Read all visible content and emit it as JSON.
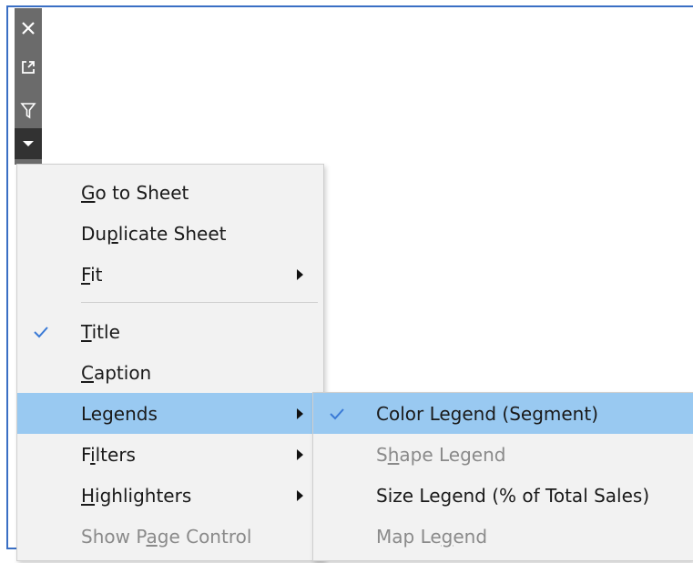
{
  "colors": {
    "toolbar": "#6b6b6b",
    "toolbar_dark": "#323232",
    "menu_bg": "#f2f2f2",
    "highlight": "#99c9f1",
    "check": "#3a7ad6",
    "disabled_text": "#8a8a8a",
    "frame": "#3a6fc4"
  },
  "toolbar": {
    "icons": [
      "close-icon",
      "popout-icon",
      "filter-icon",
      "more-options-icon"
    ]
  },
  "menu": {
    "items": [
      {
        "pre": "",
        "key": "G",
        "post": "o to Sheet"
      },
      {
        "pre": "Du",
        "key": "p",
        "post": "licate Sheet"
      },
      {
        "pre": "",
        "key": "F",
        "post": "it"
      },
      {
        "pre": "",
        "key": "T",
        "post": "itle",
        "checked": true
      },
      {
        "pre": "",
        "key": "C",
        "post": "aption"
      },
      {
        "pre": "Legends",
        "key": "",
        "post": ""
      },
      {
        "pre": "F",
        "key": "i",
        "post": "lters"
      },
      {
        "pre": "",
        "key": "H",
        "post": "ighlighters"
      },
      {
        "pre": "Show P",
        "key": "a",
        "post": "ge Control",
        "disabled": true
      }
    ]
  },
  "submenu": {
    "items": [
      {
        "pre": "Color Legend (Segment)",
        "key": "",
        "post": "",
        "checked": true
      },
      {
        "pre": "S",
        "key": "h",
        "post": "ape Legend",
        "disabled": true
      },
      {
        "pre": "Size Legend (% of Total Sales)",
        "key": "",
        "post": ""
      },
      {
        "pre": "Map Le",
        "key": "g",
        "post": "end",
        "disabled": true
      }
    ]
  }
}
